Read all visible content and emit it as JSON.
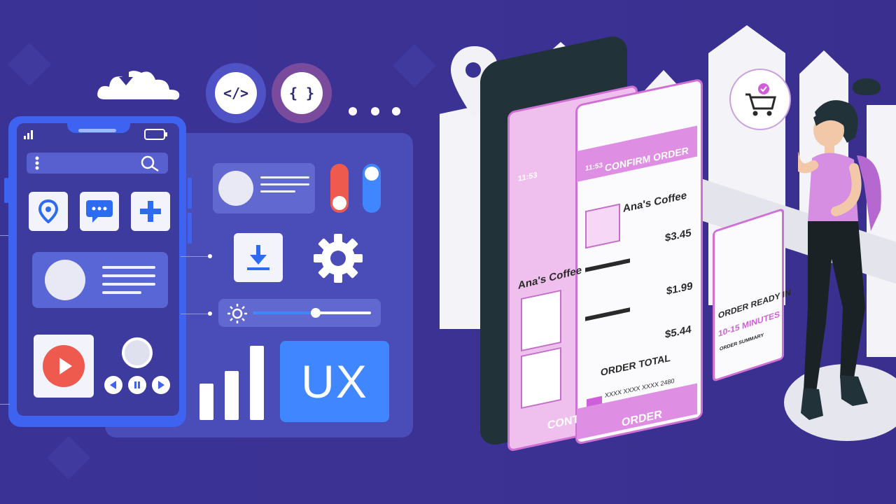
{
  "colors": {
    "background": "#3a3395",
    "phone_frame": "#3d63f0",
    "accent_blue": "#3f86ff",
    "accent_pink": "#de8fe3",
    "accent_red": "#ef5a4e"
  },
  "icons": {
    "cloud": "cloud-download-icon",
    "code": "code-icon",
    "braces": "braces-icon",
    "more": "more-dots-icon",
    "location": "location-pin-icon",
    "chat": "chat-icon",
    "add": "plus-icon",
    "download": "download-icon",
    "settings": "gear-icon",
    "brightness": "sun-icon",
    "play": "play-icon",
    "cart": "shopping-cart-icon"
  },
  "ux_tile": {
    "label": "UX"
  },
  "order_app": {
    "left_screen": {
      "time": "11:53",
      "shop_name": "Ana's Coffee",
      "button_label": "CONT"
    },
    "confirm_screen": {
      "time": "11:53",
      "header": "CONFIRM ORDER",
      "shop_name": "Ana's Coffee",
      "prices": [
        "$3.45",
        "$1.99",
        "$5.44"
      ],
      "total_label": "ORDER TOTAL",
      "card_number": "XXXX XXXX XXXX 2480",
      "order_button": "ORDER"
    },
    "ticket": {
      "title": "ORDER READY IN",
      "subtitle": "10-15 MINUTES",
      "summary": "ORDER SUMMARY"
    }
  }
}
